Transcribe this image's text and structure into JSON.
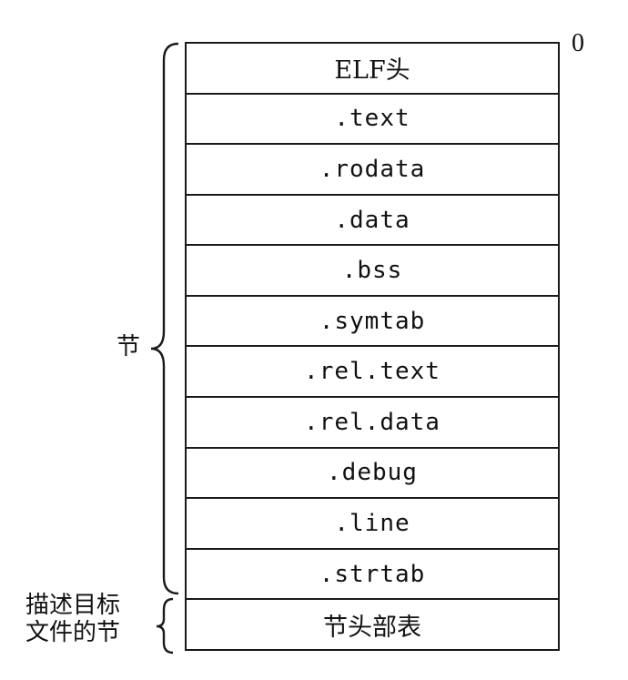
{
  "offset_label": "0",
  "sections_brace_label": "节",
  "section_header_table_label": {
    "line1": "描述目标",
    "line2": "文件的节"
  },
  "rows": [
    {
      "label": "ELF头",
      "font": "serif"
    },
    {
      "label": ".text",
      "font": "mono"
    },
    {
      "label": ".rodata",
      "font": "mono"
    },
    {
      "label": ".data",
      "font": "mono"
    },
    {
      "label": ".bss",
      "font": "mono"
    },
    {
      "label": ".symtab",
      "font": "mono"
    },
    {
      "label": ".rel.text",
      "font": "mono"
    },
    {
      "label": ".rel.data",
      "font": "mono"
    },
    {
      "label": ".debug",
      "font": "mono"
    },
    {
      "label": ".line",
      "font": "mono"
    },
    {
      "label": ".strtab",
      "font": "mono"
    },
    {
      "label": "节头部表",
      "font": "serif"
    }
  ]
}
